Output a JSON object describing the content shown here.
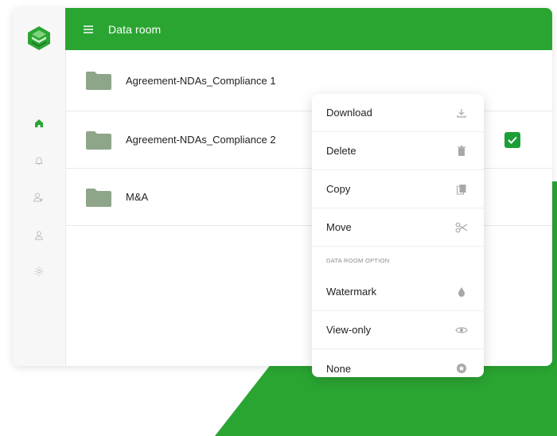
{
  "header": {
    "title": "Data room"
  },
  "sidebar": {
    "items": [
      {
        "icon": "home-icon",
        "active": true
      },
      {
        "icon": "bell-icon",
        "active": false
      },
      {
        "icon": "users-icon",
        "active": false
      },
      {
        "icon": "user-icon",
        "active": false
      },
      {
        "icon": "gear-icon",
        "active": false
      }
    ]
  },
  "files": [
    {
      "name": "Agreement-NDAs_Compliance 1",
      "checked": false
    },
    {
      "name": "Agreement-NDAs_Compliance 2",
      "checked": true
    },
    {
      "name": "M&A",
      "checked": false
    }
  ],
  "context_menu": {
    "items": [
      {
        "label": "Download",
        "icon": "download-icon"
      },
      {
        "label": "Delete",
        "icon": "trash-icon"
      },
      {
        "label": "Copy",
        "icon": "copy-icon"
      },
      {
        "label": "Move",
        "icon": "scissors-icon"
      }
    ],
    "section_title": "DATA ROOM OPTION",
    "options": [
      {
        "label": "Watermark",
        "icon": "drop-icon"
      },
      {
        "label": "View-only",
        "icon": "eye-icon"
      },
      {
        "label": "None",
        "icon": "star-icon"
      }
    ]
  },
  "colors": {
    "accent": "#2aa532",
    "folder": "#8fa58a",
    "check": "#1e9e36"
  }
}
